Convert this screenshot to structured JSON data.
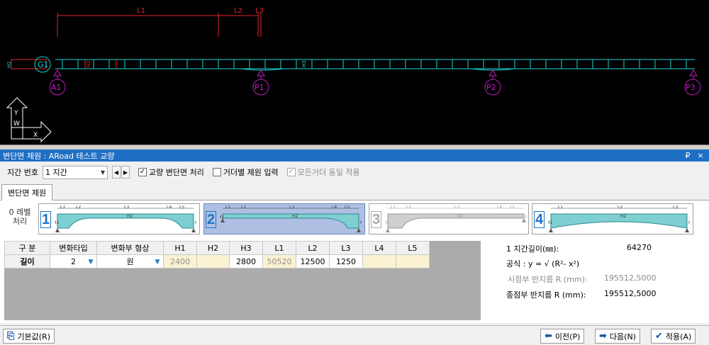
{
  "cad": {
    "dims": {
      "l1": "L1",
      "l2": "L2",
      "l3": "L3"
    },
    "girder_label": "G1",
    "piers": [
      "A1",
      "P1",
      "P2",
      "P3"
    ],
    "h_labels": {
      "h1": "H1",
      "h2": "H2",
      "h3": "H3"
    },
    "axis": {
      "y": "Y",
      "w": "W",
      "x": "X"
    }
  },
  "titlebar": {
    "title": "변단면 제원 : ARoad 테스트 교량",
    "pin": "₽",
    "close": "×"
  },
  "options": {
    "span_label": "지간 번호",
    "span_value": "1 지간",
    "chk_bridge": {
      "label": "교량 변단면 처리",
      "checked": true
    },
    "chk_girder": {
      "label": "거더별 제원 입력",
      "checked": false
    },
    "chk_all": {
      "label": "모든거더 동일 적용",
      "checked": true
    }
  },
  "tab_label": "변단면 제원",
  "types": {
    "zero": "0 레벨 처리",
    "items": [
      {
        "num": "1",
        "labels": [
          "L1",
          "L2",
          "L3",
          "L4",
          "L5",
          "H1",
          "H2",
          "H3"
        ]
      },
      {
        "num": "2",
        "labels": [
          "L1",
          "L2",
          "L3",
          "L4",
          "L5",
          "H1",
          "H2",
          "H3"
        ]
      },
      {
        "num": "3",
        "labels": [
          "L1",
          "L2",
          "L3",
          "L4",
          "L5",
          "H1",
          "H2",
          "H3"
        ]
      },
      {
        "num": "4",
        "labels": [
          "L1",
          "L2",
          "L3",
          "H1",
          "H2",
          "H3"
        ]
      }
    ]
  },
  "table": {
    "headers": [
      "구 분",
      "변화타입",
      "변화부 형상",
      "H1",
      "H2",
      "H3",
      "L1",
      "L2",
      "L3",
      "L4",
      "L5"
    ],
    "row": [
      "길이",
      "2",
      "원",
      "2400",
      "",
      "2800",
      "50520",
      "12500",
      "1250",
      "",
      ""
    ]
  },
  "info": {
    "span_len_label": "1 지간길이(㎜):",
    "span_len_value": "64270",
    "formula": "공식 : y = √ (R²- x²)",
    "start_r_label": "시점부 반지름 R (mm):",
    "start_r_value": "195512,5000",
    "end_r_label": "종점부 반지름 R (mm):",
    "end_r_value": "195512,5000"
  },
  "buttons": {
    "default": "기본값(R)",
    "prev": "이전(P)",
    "next": "다음(N)",
    "apply": "적용(A)"
  },
  "colors": {
    "cad_bg": "#000000",
    "girder": "#16d6d6",
    "pier": "#c11bc1",
    "dim": "#e4242a",
    "selected": "#aebfe3",
    "titlebar": "#1f6fc5"
  }
}
